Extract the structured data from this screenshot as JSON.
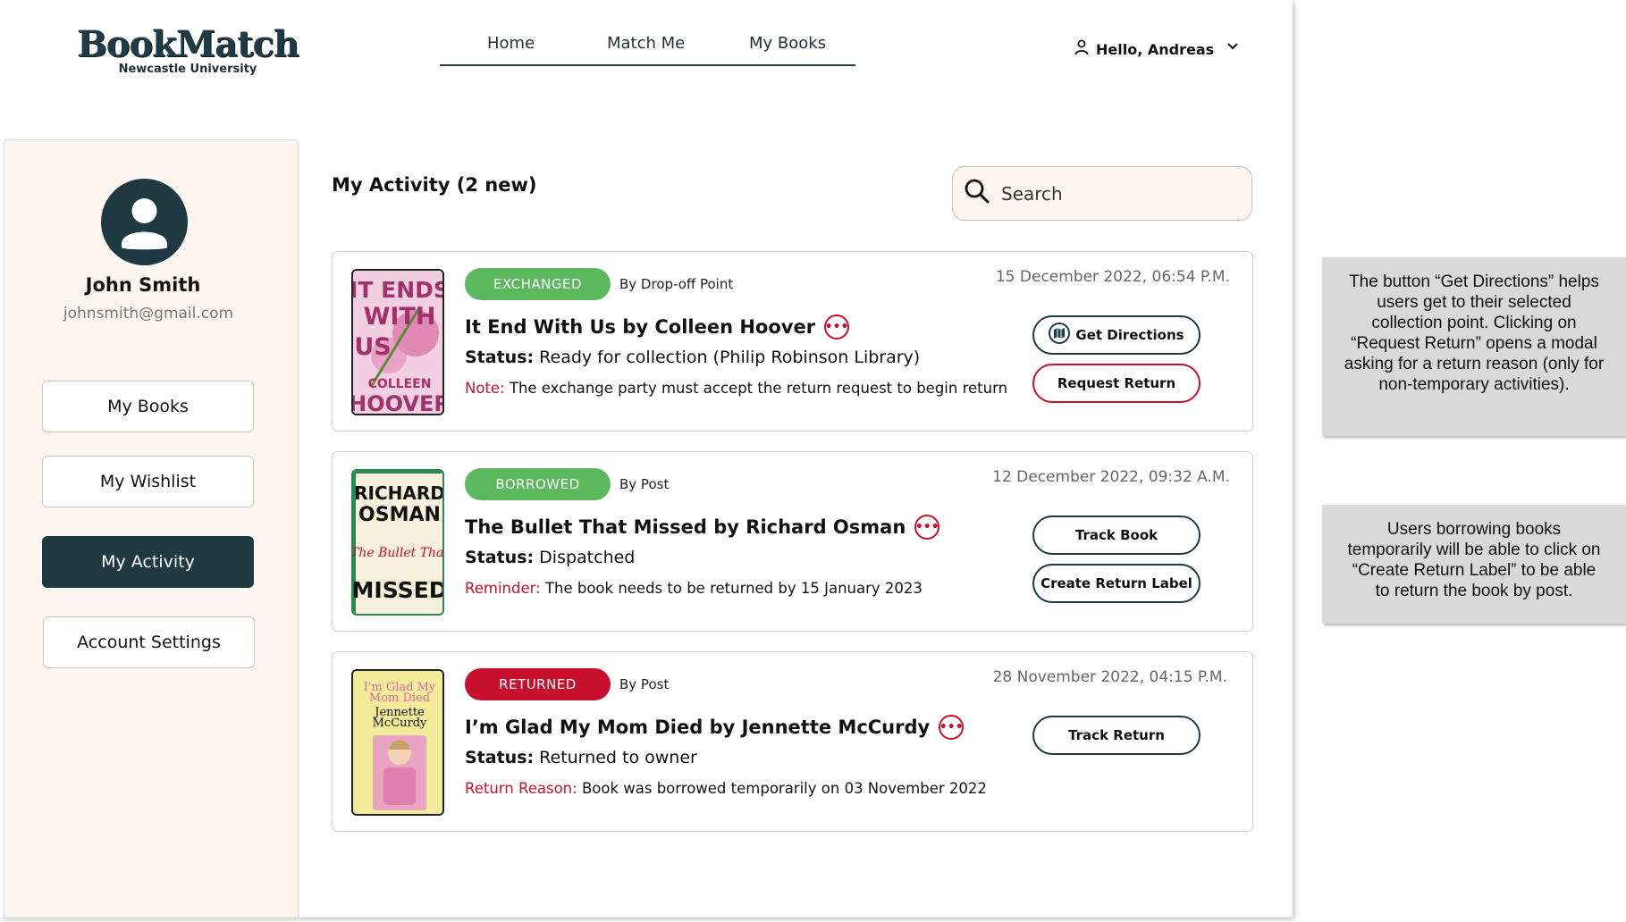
{
  "header": {
    "logo_title": "BookMatch",
    "logo_subtitle": "Newcastle University",
    "nav": [
      "Home",
      "Match Me",
      "My Books"
    ],
    "user_greeting": "Hello, Andreas"
  },
  "sidebar": {
    "name": "John Smith",
    "email": "johnsmith@gmail.com",
    "items": [
      {
        "label": "My Books",
        "active": false
      },
      {
        "label": "My Wishlist",
        "active": false
      },
      {
        "label": "My Activity",
        "active": true
      },
      {
        "label": "Account Settings",
        "active": false
      }
    ]
  },
  "main": {
    "title": "My Activity (2 new)",
    "search_placeholder": "Search"
  },
  "activities": [
    {
      "badge": "EXCHANGED",
      "badge_color": "#5cb85c",
      "method": "By Drop-off Point",
      "date": "15 December 2022, 06:54 P.M.",
      "title": "It End With Us by Colleen Hoover",
      "status_label": "Status:",
      "status": "Ready for collection (Philip Robinson Library)",
      "note_label": "Note:",
      "note": "The exchange party must accept the return request to begin return",
      "actions": [
        "Get Directions",
        "Request Return"
      ],
      "cover_text": [
        "IT ENDS",
        "WITH",
        "US",
        "COLLEEN",
        "HOOVER"
      ]
    },
    {
      "badge": "BORROWED",
      "badge_color": "#5cb85c",
      "method": "By Post",
      "date": "12 December 2022, 09:32 A.M.",
      "title": "The Bullet That Missed by Richard Osman",
      "status_label": "Status:",
      "status": "Dispatched",
      "note_label": "Reminder:",
      "note": "The book needs to be returned by 15 January 2023",
      "actions": [
        "Track Book",
        "Create Return Label"
      ],
      "cover_text": [
        "RICHARD",
        "OSMAN",
        "The Bullet That",
        "MISSED"
      ]
    },
    {
      "badge": "RETURNED",
      "badge_color": "#c8102e",
      "method": "By Post",
      "date": "28 November 2022, 04:15 P.M.",
      "title": "I’m Glad My Mom Died by Jennette McCurdy",
      "status_label": "Status:",
      "status": "Returned to owner",
      "note_label": "Return Reason:",
      "note": "Book was borrowed temporarily on 03 November 2022",
      "actions": [
        "Track Return"
      ],
      "cover_text": [
        "I'm Glad My",
        "Mom Died",
        "Jennette",
        "McCurdy"
      ]
    }
  ],
  "annotations": [
    "The button “Get Directions” helps users get to their selected collection point. Clicking on “Request Return” opens a modal asking for a return reason (only for non-temporary activities).",
    "Users borrowing books temporarily will be able to click on “Create Return Label” to be able to return the book by post."
  ],
  "colors": {
    "primary": "#1f3942",
    "accent_red": "#c8102e",
    "green": "#5cb85c",
    "sidebar_bg": "#fdf6ef"
  }
}
